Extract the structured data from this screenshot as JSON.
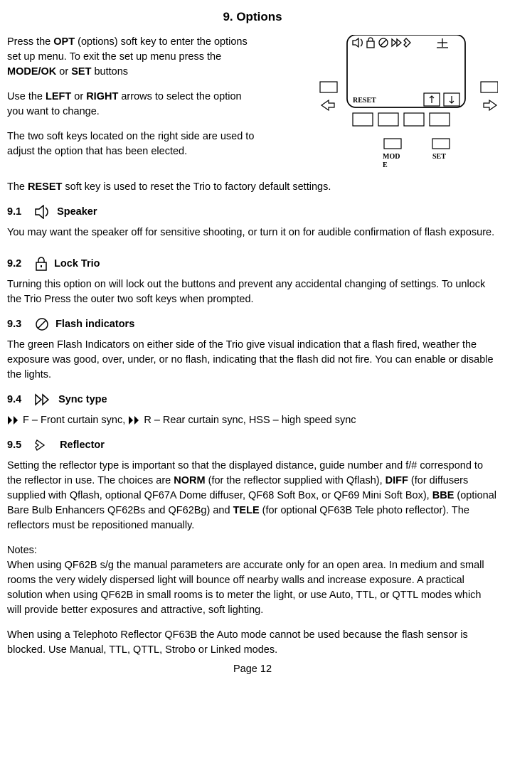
{
  "title": "9. Options",
  "intro": {
    "p1a": "Press the ",
    "p1b": "OPT",
    "p1c": " (options) soft key to enter the options set up menu. To exit the set up menu press the ",
    "p1d": "MODE/OK",
    "p1e": " or ",
    "p1f": "SET",
    "p1g": " buttons",
    "p2a": "Use the ",
    "p2b": "LEFT",
    "p2c": " or ",
    "p2d": "RIGHT",
    "p2e": " arrows to select the option you want to change.",
    "p3": "The two soft keys located on the right side are used to adjust the option that has been elected.",
    "p4a": "The ",
    "p4b": "RESET",
    "p4c": " soft key is used to reset the Trio to factory default settings."
  },
  "diagram": {
    "reset": "RESET",
    "mode": "MODE",
    "set": "SET"
  },
  "s91": {
    "num": "9.1",
    "title": "Speaker",
    "body": "You may want the speaker off for sensitive shooting, or turn it on for audible confirmation of flash exposure."
  },
  "s92": {
    "num": "9.2",
    "title": "Lock Trio",
    "body": "Turning this option on will lock out the buttons and prevent any accidental changing of settings. To unlock the Trio Press the outer two soft keys when prompted."
  },
  "s93": {
    "num": "9.3",
    "title": "Flash indicators",
    "body": "The green Flash Indicators on either side of the Trio give visual indication that a flash fired, weather the exposure was good, over, under, or no flash, indicating that the flash did not fire. You can enable or disable the lights."
  },
  "s94": {
    "num": "9.4",
    "title": "Sync type",
    "syncF": "F – Front curtain sync, ",
    "syncR": "R – Rear curtain sync, HSS – high speed sync"
  },
  "s95": {
    "num": "9.5",
    "title": "Reflector",
    "b1": "Setting the reflector type is important so that the displayed distance, guide number and f/# correspond to the reflector in use.  The choices are ",
    "k1": "NORM",
    "b2": " (for the reflector supplied with Qflash), ",
    "k2": "DIFF",
    "b3": " (for diffusers supplied with Qflash, optional QF67A Dome diffuser, QF68 Soft Box, or QF69 Mini Soft Box), ",
    "k3": "BBE",
    "b4": " (optional Bare Bulb Enhancers QF62Bs and QF62Bg) and ",
    "k4": "TELE",
    "b5": " (for optional QF63B Tele photo reflector).  The reflectors must be repositioned manually.",
    "notesLabel": "Notes:",
    "n1": "When using QF62B s/g the manual parameters are accurate only for an open area.  In medium and small rooms the very widely dispersed light will bounce off nearby walls and increase exposure.  A practical solution when using QF62B in small rooms is to meter the light, or use Auto, TTL, or QTTL modes which will provide better exposures and attractive, soft lighting.",
    "n2": "When using a Telephoto Reflector QF63B the Auto mode cannot be used because the flash sensor is blocked.  Use Manual, TTL, QTTL, Strobo or Linked modes."
  },
  "page": "Page 12"
}
